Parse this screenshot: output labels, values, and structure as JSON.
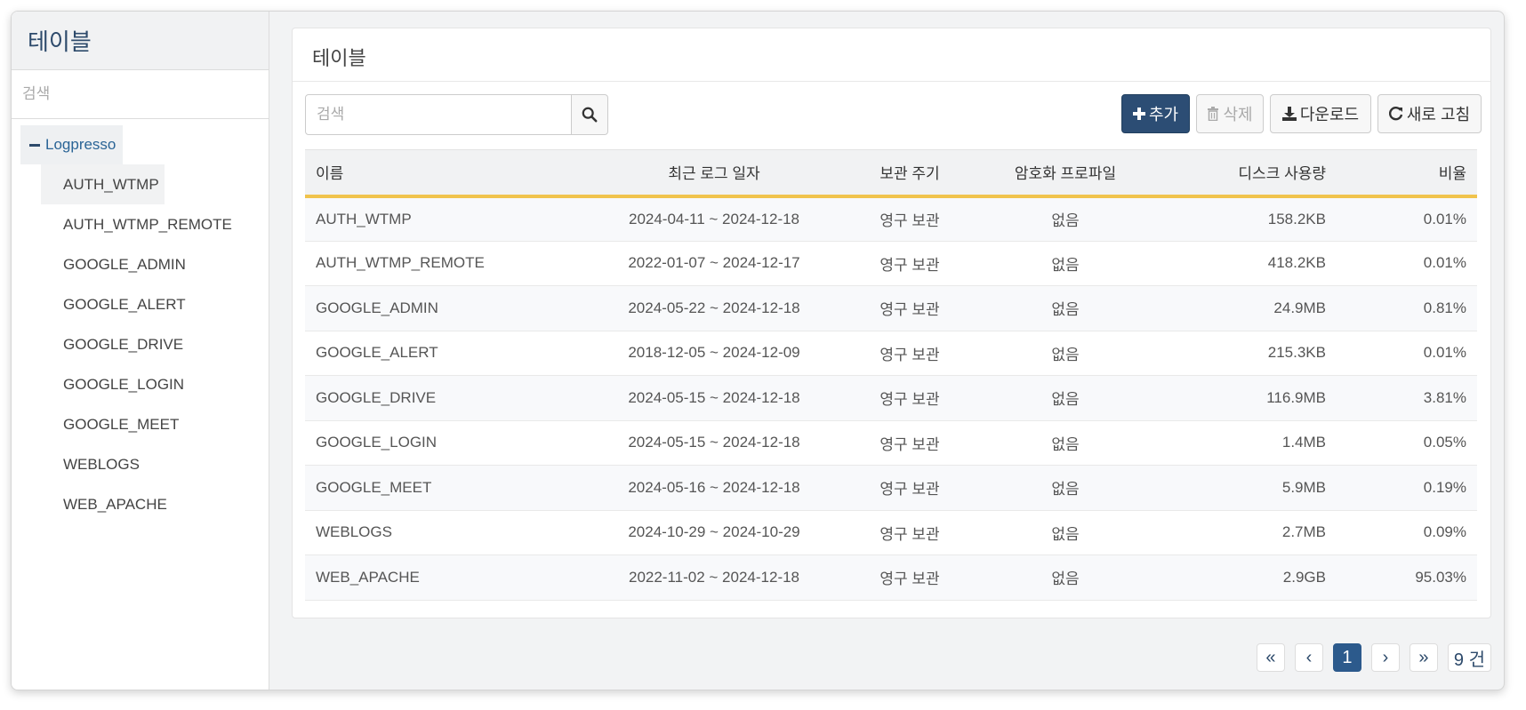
{
  "sidebar": {
    "title": "테이블",
    "search_placeholder": "검색",
    "root_label": "Logpresso",
    "items": [
      {
        "label": "AUTH_WTMP"
      },
      {
        "label": "AUTH_WTMP_REMOTE"
      },
      {
        "label": "GOOGLE_ADMIN"
      },
      {
        "label": "GOOGLE_ALERT"
      },
      {
        "label": "GOOGLE_DRIVE"
      },
      {
        "label": "GOOGLE_LOGIN"
      },
      {
        "label": "GOOGLE_MEET"
      },
      {
        "label": "WEBLOGS"
      },
      {
        "label": "WEB_APACHE"
      }
    ]
  },
  "panel": {
    "title": "테이블",
    "search_placeholder": "검색",
    "buttons": {
      "add": "추가",
      "delete": "삭제",
      "download": "다운로드",
      "refresh": "새로 고침"
    }
  },
  "table": {
    "headers": {
      "name": "이름",
      "date": "최근 로그 일자",
      "retention": "보관 주기",
      "encryption": "암호화 프로파일",
      "disk": "디스크 사용량",
      "ratio": "비율"
    },
    "rows": [
      {
        "name": "AUTH_WTMP",
        "date": "2024-04-11 ~ 2024-12-18",
        "retention": "영구 보관",
        "encryption": "없음",
        "disk": "158.2KB",
        "ratio": "0.01%"
      },
      {
        "name": "AUTH_WTMP_REMOTE",
        "date": "2022-01-07 ~ 2024-12-17",
        "retention": "영구 보관",
        "encryption": "없음",
        "disk": "418.2KB",
        "ratio": "0.01%"
      },
      {
        "name": "GOOGLE_ADMIN",
        "date": "2024-05-22 ~ 2024-12-18",
        "retention": "영구 보관",
        "encryption": "없음",
        "disk": "24.9MB",
        "ratio": "0.81%"
      },
      {
        "name": "GOOGLE_ALERT",
        "date": "2018-12-05 ~ 2024-12-09",
        "retention": "영구 보관",
        "encryption": "없음",
        "disk": "215.3KB",
        "ratio": "0.01%"
      },
      {
        "name": "GOOGLE_DRIVE",
        "date": "2024-05-15 ~ 2024-12-18",
        "retention": "영구 보관",
        "encryption": "없음",
        "disk": "116.9MB",
        "ratio": "3.81%"
      },
      {
        "name": "GOOGLE_LOGIN",
        "date": "2024-05-15 ~ 2024-12-18",
        "retention": "영구 보관",
        "encryption": "없음",
        "disk": "1.4MB",
        "ratio": "0.05%"
      },
      {
        "name": "GOOGLE_MEET",
        "date": "2024-05-16 ~ 2024-12-18",
        "retention": "영구 보관",
        "encryption": "없음",
        "disk": "5.9MB",
        "ratio": "0.19%"
      },
      {
        "name": "WEBLOGS",
        "date": "2024-10-29 ~ 2024-10-29",
        "retention": "영구 보관",
        "encryption": "없음",
        "disk": "2.7MB",
        "ratio": "0.09%"
      },
      {
        "name": "WEB_APACHE",
        "date": "2022-11-02 ~ 2024-12-18",
        "retention": "영구 보관",
        "encryption": "없음",
        "disk": "2.9GB",
        "ratio": "95.03%"
      }
    ]
  },
  "pagination": {
    "first": "«",
    "prev": "‹",
    "current_page": "1",
    "next": "›",
    "last": "»",
    "count": "9 건"
  },
  "colors": {
    "accent": "#2c4d74",
    "header_underline": "#f0c34c",
    "page_active": "#2c5a8c"
  },
  "icons": {
    "search": "search-icon",
    "add": "plus-icon",
    "delete": "trash-icon",
    "download": "download-icon",
    "refresh": "refresh-icon",
    "collapse": "minus-icon"
  }
}
